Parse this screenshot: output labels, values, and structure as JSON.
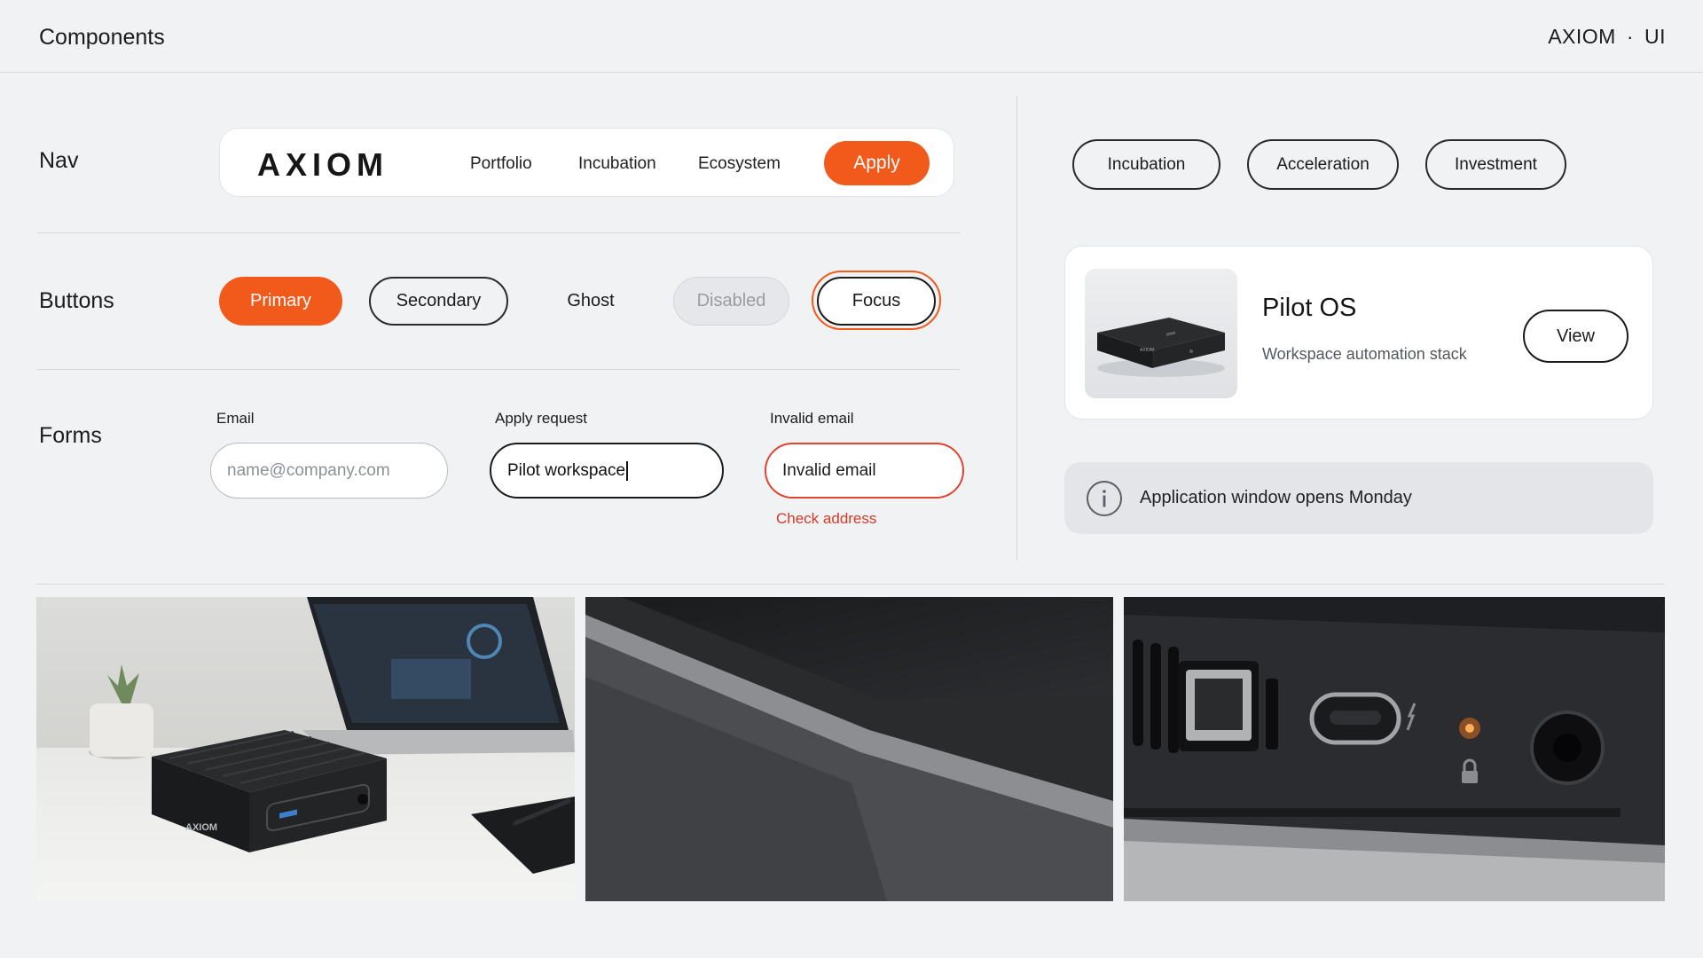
{
  "header": {
    "title": "Components",
    "brand": "AXIOM",
    "separator": "·",
    "brand_suffix": "UI"
  },
  "sections": {
    "nav": "Nav",
    "buttons": "Buttons",
    "forms": "Forms"
  },
  "nav": {
    "logo": "AXIOM",
    "links": [
      "Portfolio",
      "Incubation",
      "Ecosystem"
    ],
    "cta": "Apply"
  },
  "buttons": {
    "primary": "Primary",
    "secondary": "Secondary",
    "ghost": "Ghost",
    "disabled": "Disabled",
    "focus": "Focus"
  },
  "forms": {
    "email": {
      "label": "Email",
      "placeholder": "name@company.com"
    },
    "apply": {
      "label": "Apply request",
      "value": "Pilot workspace"
    },
    "invalid": {
      "label": "Invalid email",
      "value": "Invalid email",
      "error": "Check address"
    }
  },
  "chips": [
    "Incubation",
    "Acceleration",
    "Investment"
  ],
  "product": {
    "name": "Pilot OS",
    "subtitle": "Workspace automation stack",
    "action": "View",
    "thumb_logo": "AXIOM"
  },
  "alert": {
    "icon": "info-icon",
    "text": "Application window opens Monday"
  },
  "gallery": {
    "photo1_logo": "AXIOM",
    "photos": [
      "device-desk-photo",
      "device-edge-closeup-photo",
      "device-ports-closeup-photo"
    ]
  },
  "colors": {
    "accent": "#f25a1b",
    "error": "#e0442f",
    "background": "#f1f2f4",
    "surface": "#ffffff",
    "text": "#151515"
  }
}
